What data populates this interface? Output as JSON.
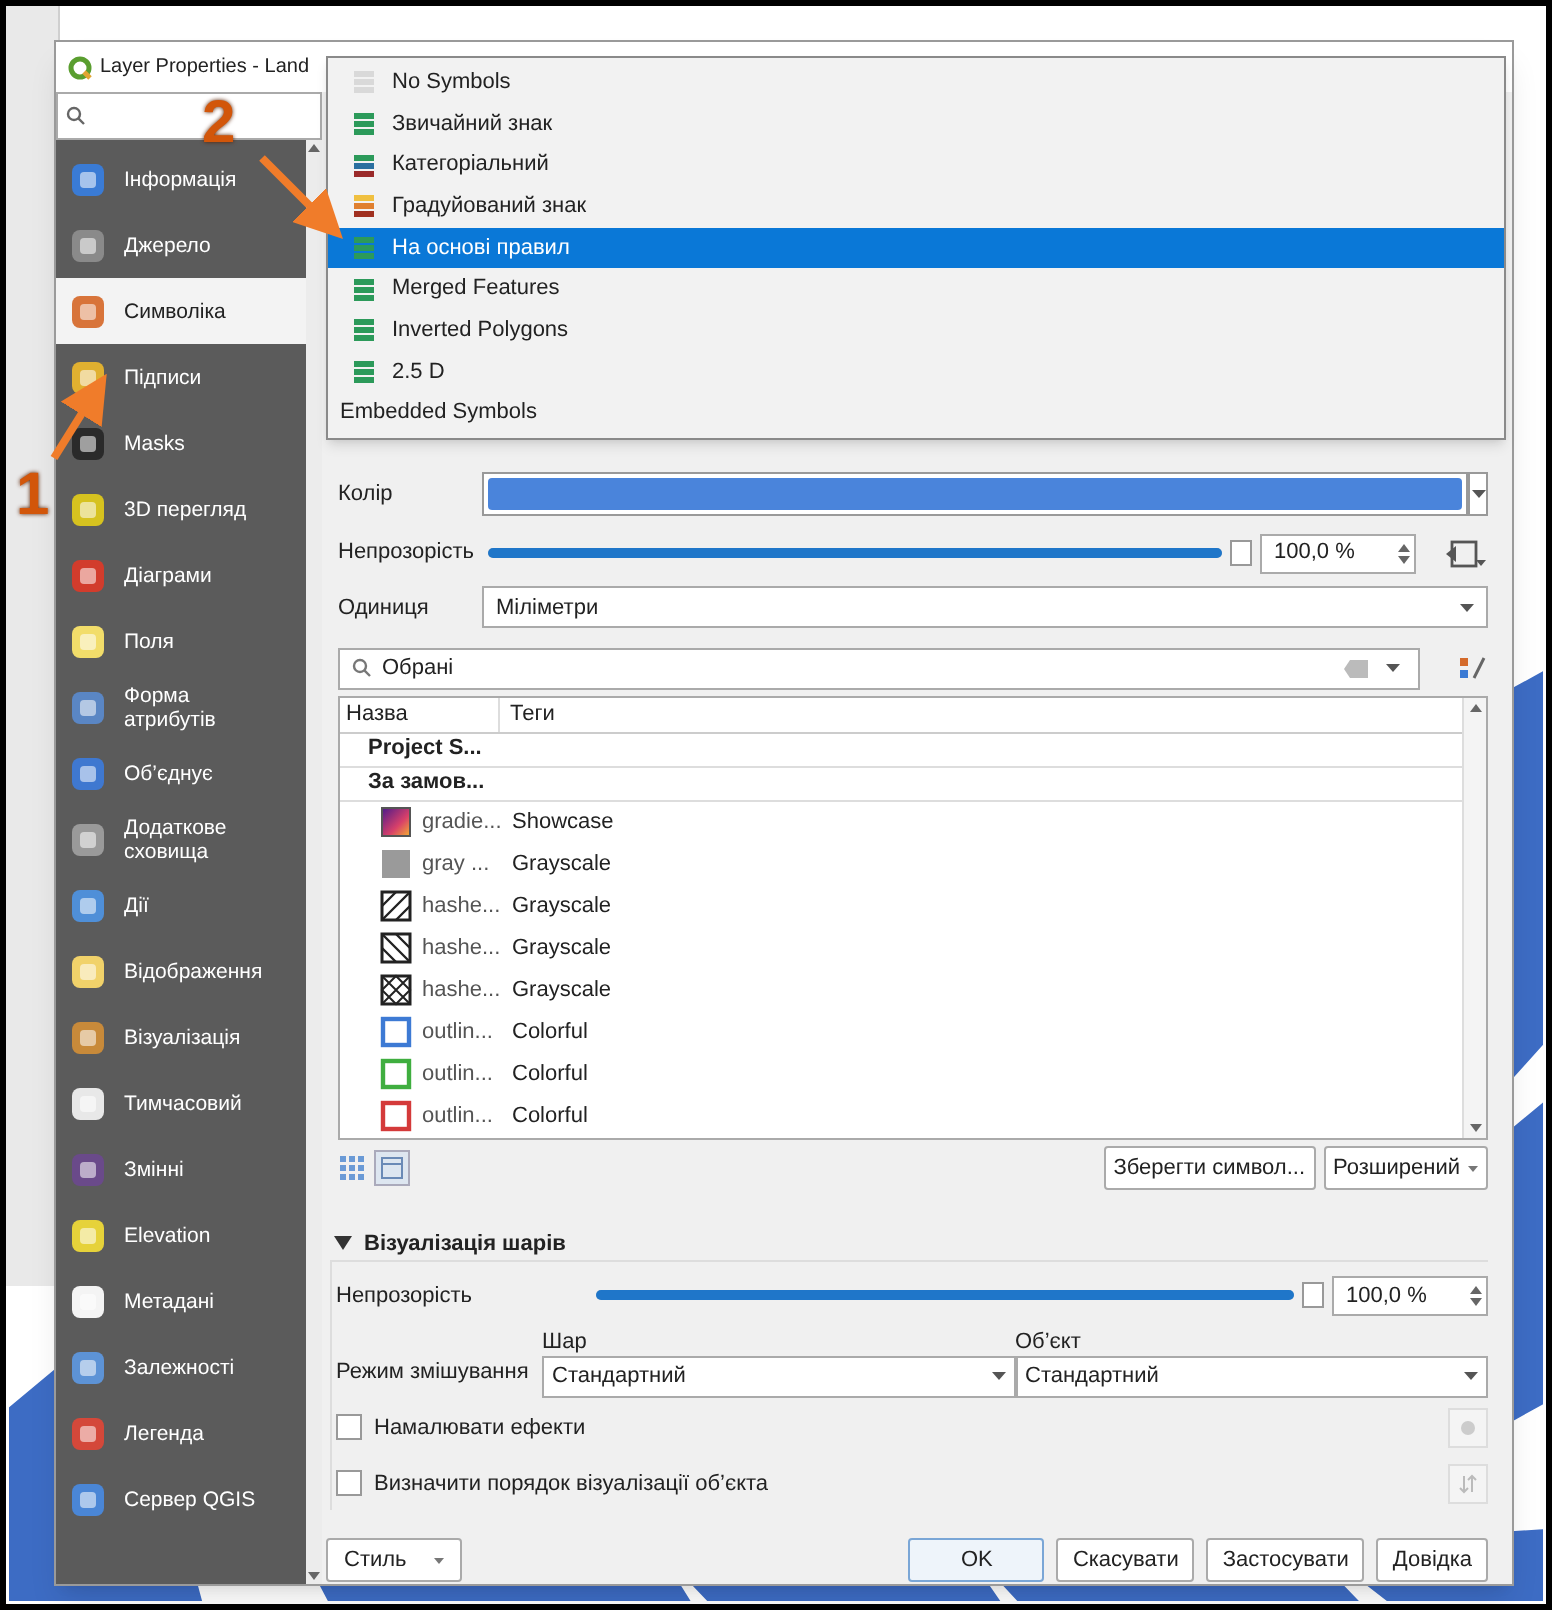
{
  "window": {
    "title": "Layer Properties - Land"
  },
  "sidebar": {
    "items": [
      {
        "label": "Інформація",
        "selected": false
      },
      {
        "label": "Джерело",
        "selected": false
      },
      {
        "label": "Символіка",
        "selected": true
      },
      {
        "label": "Підписи",
        "selected": false
      },
      {
        "label": "Masks",
        "selected": false
      },
      {
        "label": "3D перегляд",
        "selected": false
      },
      {
        "label": "Діаграми",
        "selected": false
      },
      {
        "label": "Поля",
        "selected": false
      },
      {
        "label": "Форма атрибутів",
        "selected": false
      },
      {
        "label": "Об’єднує",
        "selected": false
      },
      {
        "label": "Додаткове сховища",
        "selected": false
      },
      {
        "label": "Дії",
        "selected": false
      },
      {
        "label": "Відображення",
        "selected": false
      },
      {
        "label": "Візуалізація",
        "selected": false
      },
      {
        "label": "Тимчасовий",
        "selected": false
      },
      {
        "label": "Змінні",
        "selected": false
      },
      {
        "label": "Elevation",
        "selected": false
      },
      {
        "label": "Метадані",
        "selected": false
      },
      {
        "label": "Залежності",
        "selected": false
      },
      {
        "label": "Легенда",
        "selected": false
      },
      {
        "label": "Сервер QGIS",
        "selected": false
      }
    ]
  },
  "renderer_menu": {
    "items": [
      {
        "kind": "renderer",
        "label": "No Symbols",
        "selected": false
      },
      {
        "kind": "renderer",
        "label": "Звичайний знак",
        "selected": false
      },
      {
        "kind": "renderer",
        "label": "Категоріальний",
        "selected": false
      },
      {
        "kind": "renderer",
        "label": "Градуйований знак",
        "selected": false
      },
      {
        "kind": "renderer",
        "label": "На основі правил",
        "selected": true
      },
      {
        "kind": "renderer",
        "label": "Merged Features",
        "selected": false
      },
      {
        "kind": "renderer",
        "label": "Inverted Polygons",
        "selected": false
      },
      {
        "kind": "renderer",
        "label": "2.5 D",
        "selected": false
      },
      {
        "kind": "heading",
        "label": "Embedded Symbols",
        "selected": false
      }
    ]
  },
  "symbol": {
    "color": {
      "label": "Колір",
      "color": "#4a84db"
    },
    "opacity": {
      "label": "Непрозорість",
      "level": 1,
      "value": "100,0 %"
    },
    "unit": {
      "label": "Одиниця",
      "value": "Міліметри"
    },
    "library_search": {
      "value": "Обрані"
    },
    "table": {
      "columns": [
        "Назва",
        "Теги"
      ],
      "rows": [
        {
          "kind": "group",
          "name": "Project S..."
        },
        {
          "kind": "group",
          "name": "За замов..."
        },
        {
          "kind": "gradient",
          "name": "gradie...",
          "tag": "Showcase"
        },
        {
          "kind": "gray",
          "name": "gray ...",
          "tag": "Grayscale"
        },
        {
          "kind": "hash-forward",
          "name": "hashe...",
          "tag": "Grayscale"
        },
        {
          "kind": "hash-back",
          "name": "hashe...",
          "tag": "Grayscale"
        },
        {
          "kind": "hash-cross",
          "name": "hashe...",
          "tag": "Grayscale"
        },
        {
          "kind": "outline",
          "name": "outlin...",
          "tag": "Colorful",
          "color": "#3d7ad4"
        },
        {
          "kind": "outline",
          "name": "outlin...",
          "tag": "Colorful",
          "color": "#3fae3f"
        },
        {
          "kind": "outline",
          "name": "outlin...",
          "tag": "Colorful",
          "color": "#d43a3a"
        }
      ]
    },
    "buttons": [
      "Зберегти символ...",
      "Розширений"
    ]
  },
  "layer_rendering": {
    "title": "Візуалізація шарів",
    "expanded": true,
    "opacity": {
      "label": "Непрозорість",
      "level": 1,
      "value": "100,0 %"
    },
    "blend": {
      "label": "Режим змішування",
      "layer_label": "Шар",
      "layer_value": "Стандартний",
      "feature_label": "Об’єкт",
      "feature_value": "Стандартний"
    },
    "checkboxes": [
      {
        "label": "Намалювати ефекти",
        "checked": false
      },
      {
        "label": "Визначити порядок візуалізації об’єкта",
        "checked": false
      }
    ]
  },
  "footer": {
    "style_button": "Стиль",
    "buttons": [
      "OK",
      "Скасувати",
      "Застосувати",
      "Довідка"
    ]
  },
  "annotations": [
    {
      "label": "1"
    },
    {
      "label": "2"
    }
  ]
}
